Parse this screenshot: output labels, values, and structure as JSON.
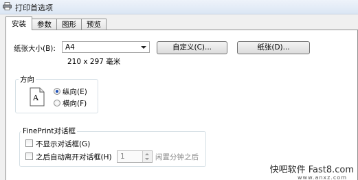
{
  "window": {
    "title": "打印首选项",
    "icon": "printer-icon"
  },
  "tabs": [
    {
      "label": "安装",
      "active": true
    },
    {
      "label": "参数",
      "active": false
    },
    {
      "label": "图形",
      "active": false
    },
    {
      "label": "预览",
      "active": false
    }
  ],
  "paper": {
    "size_label": "纸张大小(B):",
    "size_value": "A4",
    "dimensions": "210 x 297 毫米",
    "custom_button": "自定义(C)...",
    "paper_button": "纸张(D)..."
  },
  "orientation": {
    "group_title": "方向",
    "icon": "page-orientation-icon",
    "icon_letter": "A",
    "portrait": "纵向(E)",
    "landscape": "横向(F)",
    "selected": "portrait"
  },
  "fineprint_dialog": {
    "group_title": "FinePrint对话框",
    "no_dialog": "不显示对话框(G)",
    "auto_leave": "之后自动离开对话框(H)",
    "minutes_value": "1",
    "minutes_suffix": "闲置分钟之后"
  },
  "watermark": {
    "text": "快吧软件 Fast8.com",
    "subtext": "www.anxz.com"
  }
}
